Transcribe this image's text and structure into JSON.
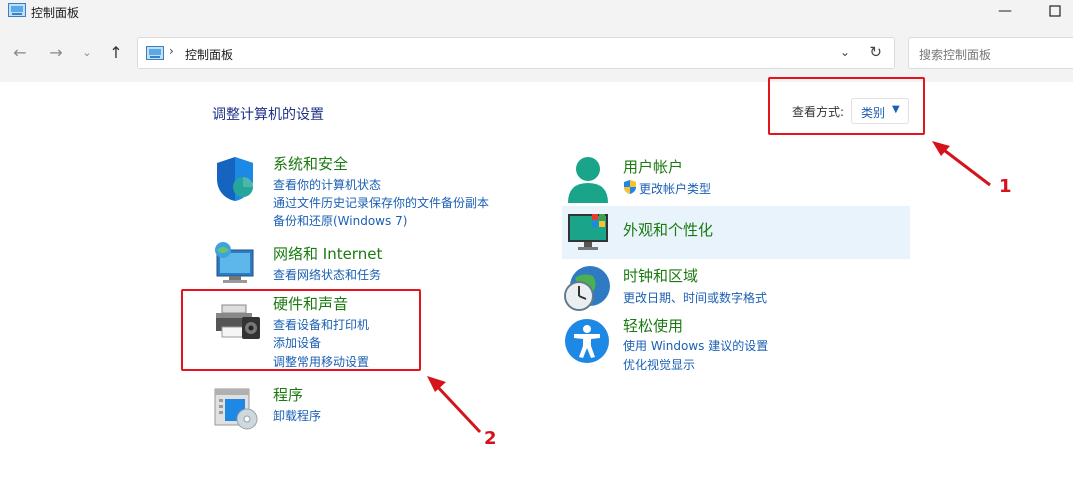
{
  "window": {
    "title": "控制面板"
  },
  "nav": {
    "breadcrumb": "控制面板",
    "search_placeholder": "搜索控制面板"
  },
  "main": {
    "heading": "调整计算机的设置",
    "view_by_label": "查看方式:",
    "view_by_value": "类别"
  },
  "categories": [
    {
      "title": "系统和安全",
      "links": [
        "查看你的计算机状态",
        "通过文件历史记录保存你的文件备份副本",
        "备份和还原(Windows 7)"
      ]
    },
    {
      "title": "网络和 Internet",
      "links": [
        "查看网络状态和任务"
      ]
    },
    {
      "title": "硬件和声音",
      "links": [
        "查看设备和打印机",
        "添加设备",
        "调整常用移动设置"
      ]
    },
    {
      "title": "程序",
      "links": [
        "卸载程序"
      ]
    },
    {
      "title": "用户帐户",
      "links": [
        "更改帐户类型"
      ]
    },
    {
      "title": "外观和个性化",
      "links": []
    },
    {
      "title": "时钟和区域",
      "links": [
        "更改日期、时间或数字格式"
      ]
    },
    {
      "title": "轻松使用",
      "links": [
        "使用 Windows 建议的设置",
        "优化视觉显示"
      ]
    }
  ],
  "annotations": {
    "one": "1",
    "two": "2"
  },
  "colors": {
    "accent_red": "#e5131b",
    "link_blue": "#1a5fb4",
    "title_green": "#1a7a10",
    "highlight": "#e8f3fc"
  }
}
